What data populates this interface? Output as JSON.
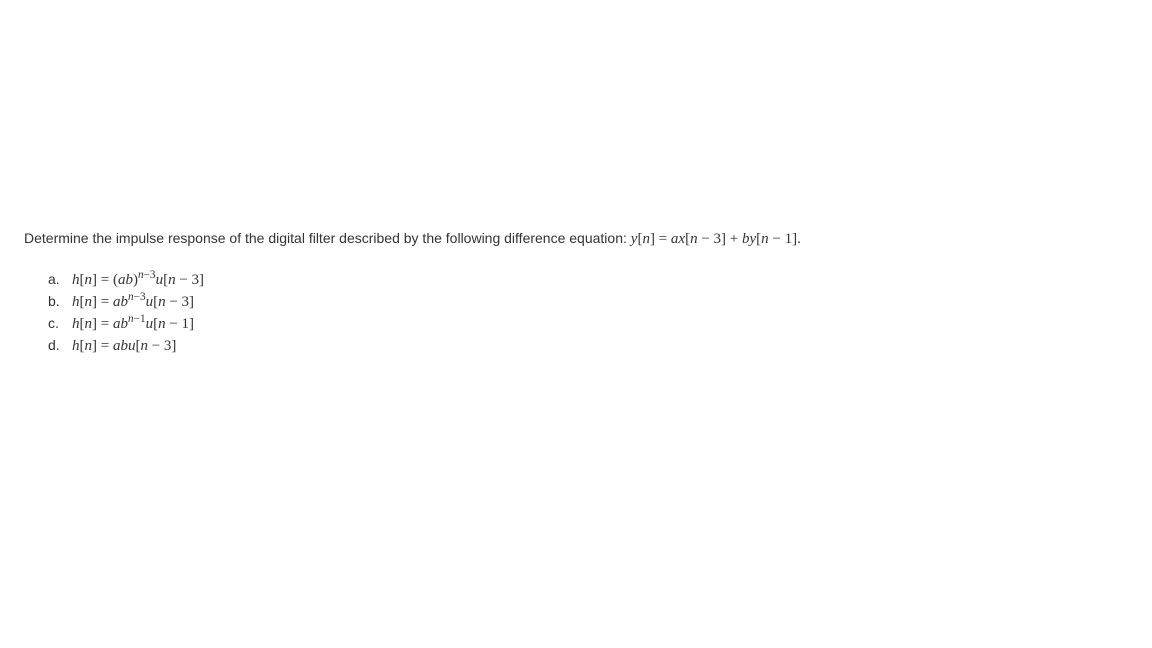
{
  "question": {
    "prompt_prefix": "Determine the impulse response of the digital filter described by the following difference equation: ",
    "equation": "y[n] = ax[n − 3] + by[n − 1].",
    "options": [
      {
        "label": "a.",
        "formula": "h[n] = (ab)^{n−3}u[n − 3]"
      },
      {
        "label": "b.",
        "formula": "h[n] = ab^{n−3}u[n − 3]"
      },
      {
        "label": "c.",
        "formula": "h[n] = ab^{n−1}u[n − 1]"
      },
      {
        "label": "d.",
        "formula": "h[n] = abu[n − 3]"
      }
    ]
  }
}
